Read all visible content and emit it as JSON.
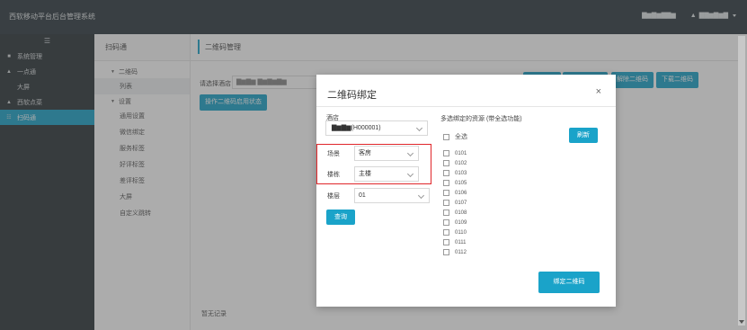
{
  "app": {
    "title": "西软移动平台后台管理系统"
  },
  "topbar": {
    "right_a": "▇▆▇▆▇▇▆",
    "right_b": "▇▇▆▇▆▇"
  },
  "leftnav": {
    "toggle": "☰",
    "items": [
      {
        "icon": "■",
        "label": "系统管理"
      },
      {
        "icon": "▲",
        "label": "一点通"
      },
      {
        "icon": "",
        "label": "大屏"
      },
      {
        "icon": "▲",
        "label": "西软点菜"
      },
      {
        "icon": "☷",
        "label": "扫码通"
      }
    ]
  },
  "subnav": {
    "title": "扫码通",
    "group1": "二维码",
    "item_list": "列表",
    "group2": "设置",
    "items": [
      "通用设置",
      "微信绑定",
      "服务标签",
      "好评标签",
      "差评标签",
      "大屏",
      "自定义跳转"
    ]
  },
  "main": {
    "header": "二维码管理",
    "filter_label": "请选择酒店",
    "filter_value": "▇▆▇▆ ▇▆▇▆▇▆",
    "btn_enable": "操作二维码启用状态",
    "btn_unbind": "解除二维码",
    "btn_download": "下载二维码",
    "empty": "暂无记录"
  },
  "modal": {
    "title": "二维码绑定",
    "store_label": "酒店",
    "store_value": "▇▆▇▆(H000001)",
    "scene_label": "场景",
    "scene_value": "客房",
    "floor_label": "楼栋",
    "floor_value": "主楼",
    "level_label": "楼层",
    "level_value": "01",
    "query": "查询",
    "res_title": "多选绑定的资源 (带全选功能)",
    "select_all": "全选",
    "refresh": "刷新",
    "rooms": [
      "0101",
      "0102",
      "0103",
      "0105",
      "0106",
      "0107",
      "0108",
      "0109",
      "0110",
      "0111",
      "0112"
    ],
    "bind": "绑定二维码"
  }
}
